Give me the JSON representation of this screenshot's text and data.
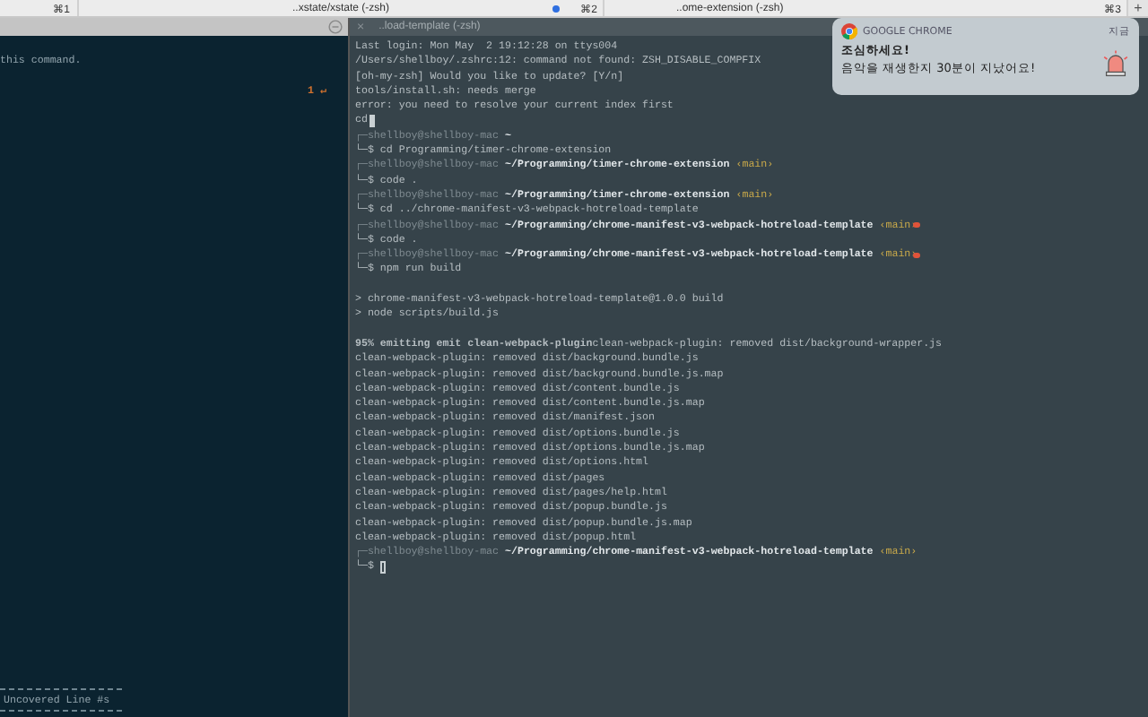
{
  "tab_bar": {
    "tabs": [
      {
        "shortcut": "⌘1"
      },
      {
        "title": "..xstate/xstate (-zsh)",
        "shortcut": "⌘2",
        "activity": true
      },
      {
        "title": "..ome-extension (-zsh)",
        "shortcut": "⌘3",
        "activity": false
      }
    ],
    "new_tab": "+"
  },
  "left_pane": {
    "lines": [
      {
        "kind": "blank"
      },
      {
        "kind": "plain",
        "text": "this command."
      },
      {
        "kind": "blank"
      },
      {
        "kind": "marker",
        "text": "1 ↵"
      }
    ],
    "footer": "Uncovered Line #s"
  },
  "right_pane": {
    "title": "..load-template (-zsh)",
    "close": "×",
    "lines": [
      {
        "kind": "plain",
        "text": "Last login: Mon May  2 19:12:28 on ttys004"
      },
      {
        "kind": "plain",
        "text": "/Users/shellboy/.zshrc:12: command not found: ZSH_DISABLE_COMPFIX"
      },
      {
        "kind": "plain",
        "text": "[oh-my-zsh] Would you like to update? [Y/n]"
      },
      {
        "kind": "plain",
        "text": "tools/install.sh: needs merge"
      },
      {
        "kind": "plain",
        "text": "error: you need to resolve your current index first"
      },
      {
        "kind": "input",
        "text": "cd",
        "cursor_filled": true
      },
      {
        "kind": "prompt",
        "user": "┌─shellboy@shellboy-mac",
        "path": "~"
      },
      {
        "kind": "command",
        "text": "└─$ cd Programming/timer-chrome-extension"
      },
      {
        "kind": "prompt",
        "user": "┌─shellboy@shellboy-mac",
        "path": "~/Programming/timer-chrome-extension",
        "branch": "‹main›",
        "dirty": false
      },
      {
        "kind": "command",
        "text": "└─$ code ."
      },
      {
        "kind": "prompt",
        "user": "┌─shellboy@shellboy-mac",
        "path": "~/Programming/timer-chrome-extension",
        "branch": "‹main›",
        "dirty": false
      },
      {
        "kind": "command",
        "text": "└─$ cd ../chrome-manifest-v3-webpack-hotreload-template"
      },
      {
        "kind": "prompt",
        "user": "┌─shellboy@shellboy-mac",
        "path": "~/Programming/chrome-manifest-v3-webpack-hotreload-template",
        "branch": "‹main›",
        "dirty": true
      },
      {
        "kind": "command",
        "text": "└─$ code ."
      },
      {
        "kind": "prompt",
        "user": "┌─shellboy@shellboy-mac",
        "path": "~/Programming/chrome-manifest-v3-webpack-hotreload-template",
        "branch": "‹main›",
        "dirty": true
      },
      {
        "kind": "command",
        "text": "└─$ npm run build"
      },
      {
        "kind": "blank"
      },
      {
        "kind": "plain",
        "text": "> chrome-manifest-v3-webpack-hotreload-template@1.0.0 build"
      },
      {
        "kind": "plain",
        "text": "> node scripts/build.js"
      },
      {
        "kind": "blank"
      },
      {
        "kind": "plain",
        "text": "**95% emitting emit clean-webpack-plugin**clean-webpack-plugin: removed dist/background-wrapper.js"
      },
      {
        "kind": "plain",
        "text": "clean-webpack-plugin: removed dist/background.bundle.js"
      },
      {
        "kind": "plain",
        "text": "clean-webpack-plugin: removed dist/background.bundle.js.map"
      },
      {
        "kind": "plain",
        "text": "clean-webpack-plugin: removed dist/content.bundle.js"
      },
      {
        "kind": "plain",
        "text": "clean-webpack-plugin: removed dist/content.bundle.js.map"
      },
      {
        "kind": "plain",
        "text": "clean-webpack-plugin: removed dist/manifest.json"
      },
      {
        "kind": "plain",
        "text": "clean-webpack-plugin: removed dist/options.bundle.js"
      },
      {
        "kind": "plain",
        "text": "clean-webpack-plugin: removed dist/options.bundle.js.map"
      },
      {
        "kind": "plain",
        "text": "clean-webpack-plugin: removed dist/options.html"
      },
      {
        "kind": "plain",
        "text": "clean-webpack-plugin: removed dist/pages"
      },
      {
        "kind": "plain",
        "text": "clean-webpack-plugin: removed dist/pages/help.html"
      },
      {
        "kind": "plain",
        "text": "clean-webpack-plugin: removed dist/popup.bundle.js"
      },
      {
        "kind": "plain",
        "text": "clean-webpack-plugin: removed dist/popup.bundle.js.map"
      },
      {
        "kind": "plain",
        "text": "clean-webpack-plugin: removed dist/popup.html"
      },
      {
        "kind": "prompt",
        "user": "┌─shellboy@shellboy-mac",
        "path": "~/Programming/chrome-manifest-v3-webpack-hotreload-template",
        "branch": "‹main›",
        "dirty": false
      },
      {
        "kind": "input",
        "text": "└─$",
        "cursor_filled": false
      }
    ]
  },
  "notification": {
    "app": "GOOGLE CHROME",
    "time": "지금",
    "title": "조심하세요!",
    "body": "음악을 재생한지 30분이 지났어요!"
  }
}
